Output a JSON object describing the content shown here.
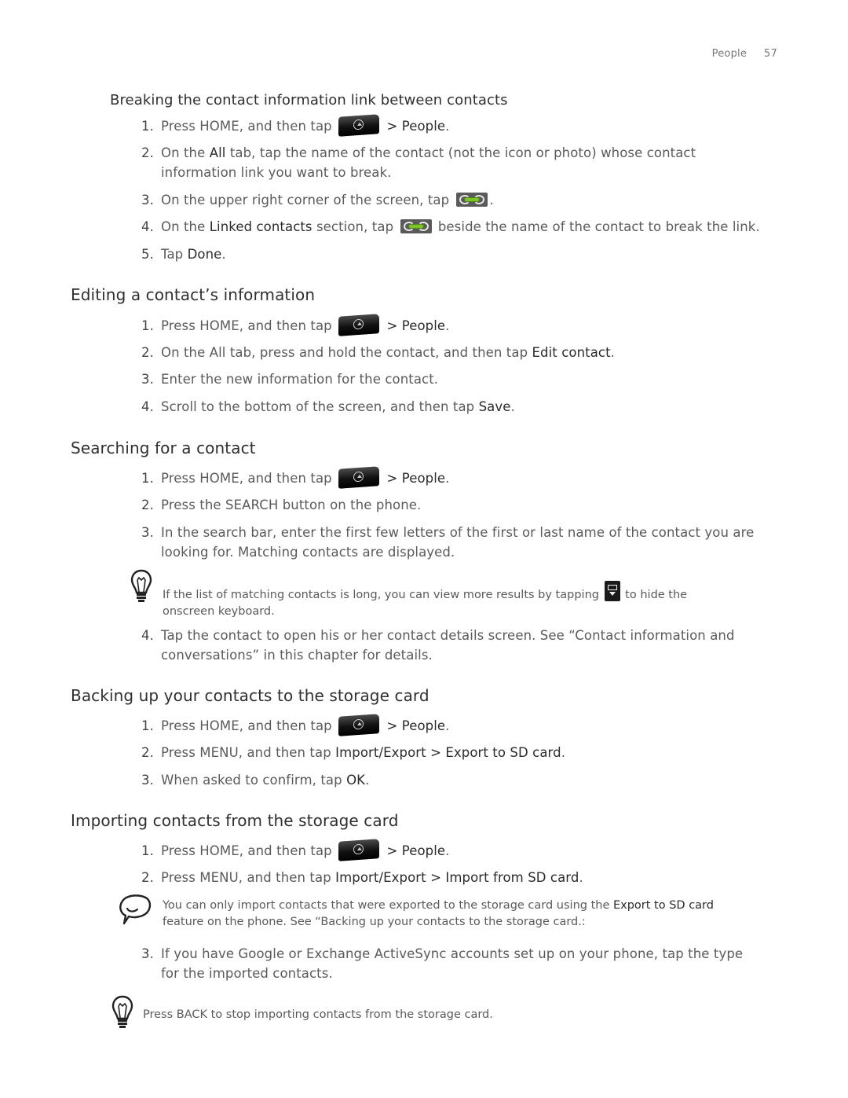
{
  "header": {
    "section": "People",
    "page_number": "57"
  },
  "sections": [
    {
      "title": "Breaking the contact information link between contacts",
      "steps": [
        {
          "num": "1.",
          "pre": "Press HOME, and then tap",
          "icon": "all-apps-icon",
          "post": "> People",
          "end": "."
        },
        {
          "num": "2.",
          "a": "On the ",
          "b": "All",
          "c": " tab, tap the name of the contact (not the icon or photo) whose contact",
          "d": "information link you want to break."
        },
        {
          "num": "3.",
          "pre": "On the upper right corner of the screen, tap",
          "icon": "link-icon",
          "end": "."
        },
        {
          "num": "4.",
          "a": "On the ",
          "b": "Linked contacts",
          "c": " section, tap",
          "icon": "link-icon",
          "d": " beside the name of the contact to break the link."
        },
        {
          "num": "5.",
          "a": "Tap ",
          "b": "Done",
          "end": "."
        }
      ]
    },
    {
      "title": "Editing a contact’s information",
      "steps": [
        {
          "num": "1.",
          "pre": "Press HOME, and then tap",
          "icon": "all-apps-icon",
          "post": "> People",
          "end": "."
        },
        {
          "num": "2.",
          "a": "On the All tab, press and hold the contact, and then tap ",
          "b": "Edit contact",
          "end": "."
        },
        {
          "num": "3.",
          "a": "Enter the new information for the contact."
        },
        {
          "num": "4.",
          "a": "Scroll to the bottom of the screen, and then tap ",
          "b": "Save",
          "end": "."
        }
      ]
    },
    {
      "title": "Searching for a contact",
      "steps": [
        {
          "num": "1.",
          "pre": "Press HOME, and then tap",
          "icon": "all-apps-icon",
          "post": "> People",
          "end": "."
        },
        {
          "num": "2.",
          "a": "Press the SEARCH button on the phone."
        },
        {
          "num": "3.",
          "a": "In the search bar, enter the first few letters of the first or last name of the contact you are",
          "d": "looking for. Matching contacts are displayed."
        },
        {
          "num": "4.",
          "a": "Tap the contact to open his or her contact details screen. See “Contact information and",
          "d": "conversations” in this chapter for details."
        }
      ],
      "tip": {
        "a": "If the list of matching contacts is long, you can view more results by tapping",
        "icon": "hide-keyboard-icon",
        "b": " to hide the",
        "c": "onscreen keyboard."
      }
    },
    {
      "title": "Backing up your contacts to the storage card",
      "steps": [
        {
          "num": "1.",
          "pre": "Press HOME, and then tap",
          "icon": "all-apps-icon",
          "post": "> People",
          "end": "."
        },
        {
          "num": "2.",
          "a": "Press MENU, and then tap ",
          "b": "Import/Export > Export to SD card",
          "end": "."
        },
        {
          "num": "3.",
          "a": "When asked to confirm, tap ",
          "b": "OK",
          "end": "."
        }
      ]
    },
    {
      "title": "Importing contacts from the storage card",
      "steps": [
        {
          "num": "1.",
          "pre": "Press HOME, and then tap",
          "icon": "all-apps-icon",
          "post": "> People",
          "end": "."
        },
        {
          "num": "2.",
          "a": "Press MENU, and then tap ",
          "b": "Import/Export > Import from SD card",
          "end": "."
        },
        {
          "num": "3.",
          "a": "If you have Google or Exchange ActiveSync accounts set up on your phone, tap the type",
          "d": "for the imported contacts."
        }
      ],
      "note": {
        "a": "You can only import contacts that were exported to the storage card using the ",
        "b": "Export to SD card",
        "c": "feature on the phone. See “Backing up your contacts to the storage card.:"
      },
      "tip": {
        "a": "Press BACK to stop importing contacts from the storage card."
      }
    }
  ]
}
